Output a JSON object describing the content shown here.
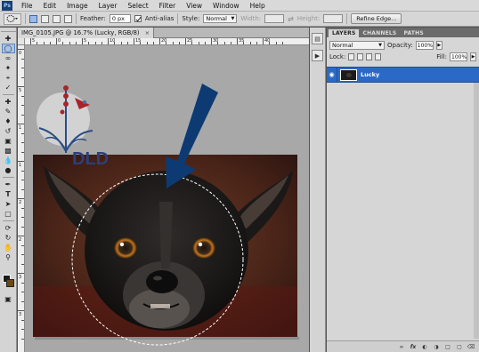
{
  "app": {
    "logo": "Ps"
  },
  "menu": [
    "File",
    "Edit",
    "Image",
    "Layer",
    "Select",
    "Filter",
    "View",
    "Window",
    "Help"
  ],
  "options": {
    "feather_label": "Feather:",
    "feather_value": "0 px",
    "antialias_label": "Anti-alias",
    "style_label": "Style:",
    "style_value": "Normal",
    "width_label": "Width:",
    "height_label": "Height:",
    "refine_label": "Refine Edge..."
  },
  "document": {
    "tab_title": "IMG_0105.JPG @ 16.7% (Lucky, RGB/8)",
    "tab_close": "×",
    "ruler_top_labels": [
      "5",
      "0",
      "5",
      "10",
      "15",
      "20",
      "25",
      "30",
      "35",
      "40"
    ],
    "ruler_left_labels": [
      "0",
      "5",
      "1",
      "1",
      "2",
      "2",
      "3",
      "3"
    ]
  },
  "logo": {
    "text": "DLD"
  },
  "layers_panel": {
    "tabs": [
      "LAYERS",
      "CHANNELS",
      "PATHS"
    ],
    "blend_mode": "Normal",
    "opacity_label": "Opacity:",
    "opacity_value": "100%",
    "lock_label": "Lock:",
    "fill_label": "Fill:",
    "fill_value": "100%",
    "layer_name": "Lucky"
  },
  "colors": {
    "arrow": "#0d3a73",
    "selection": "#ffffff",
    "layer_highlight": "#2b69c6",
    "foreground": "#1a1a1a",
    "background": "#6b4a12"
  }
}
